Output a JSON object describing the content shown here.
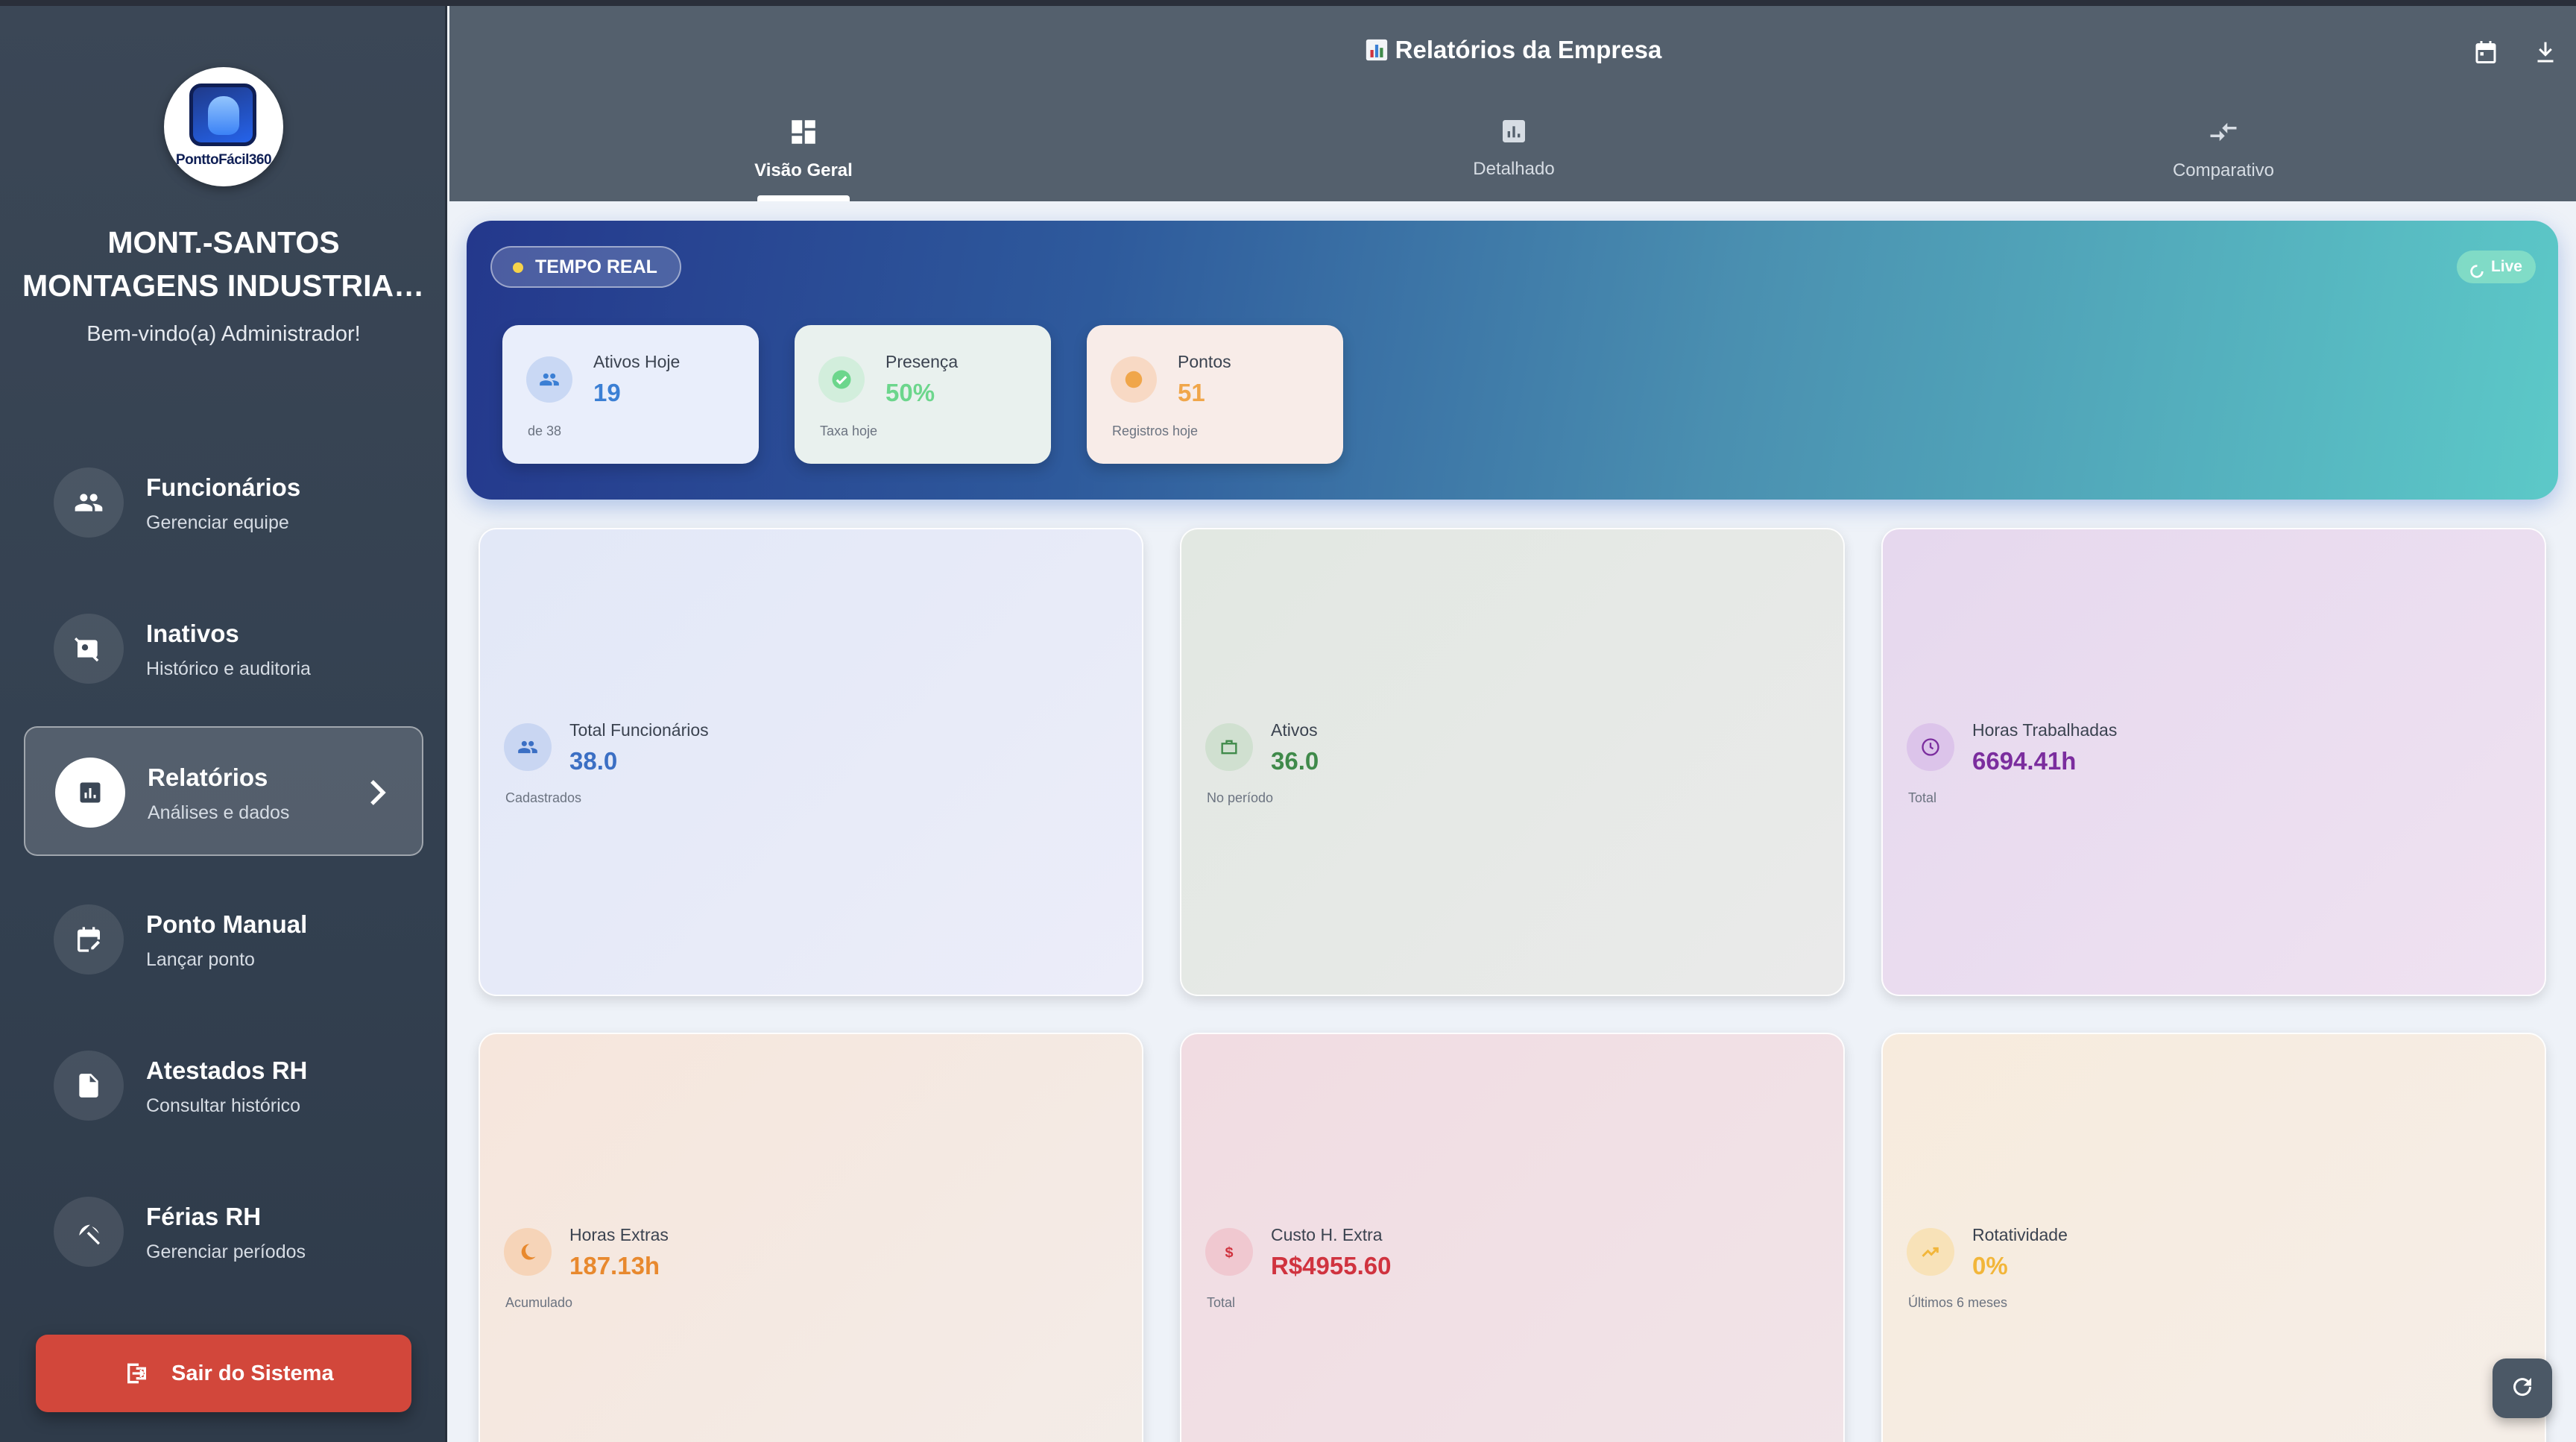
{
  "sidebar": {
    "logo_text": "PonttoFácil360",
    "company_line1": "MONT.-SANTOS",
    "company_line2": "MONTAGENS INDUSTRIAI...",
    "welcome": "Bem-vindo(a) Administrador!",
    "items": [
      {
        "label": "Funcionários",
        "sub": "Gerenciar equipe",
        "icon": "people-icon"
      },
      {
        "label": "Inativos",
        "sub": "Histórico e auditoria",
        "icon": "person-off-icon"
      },
      {
        "label": "Relatórios",
        "sub": "Análises e dados",
        "icon": "analytics-icon",
        "active": true
      },
      {
        "label": "Ponto Manual",
        "sub": "Lançar ponto",
        "icon": "edit-calendar-icon"
      },
      {
        "label": "Atestados RH",
        "sub": "Consultar histórico",
        "icon": "document-icon"
      },
      {
        "label": "Férias RH",
        "sub": "Gerenciar períodos",
        "icon": "beach-icon"
      }
    ],
    "logout_label": "Sair do Sistema"
  },
  "header": {
    "title": "Relatórios da Empresa",
    "tabs": [
      {
        "label": "Visão Geral",
        "icon": "dashboard-icon",
        "active": true
      },
      {
        "label": "Detalhado",
        "icon": "bar-chart-icon"
      },
      {
        "label": "Comparativo",
        "icon": "compare-arrows-icon"
      }
    ]
  },
  "realtime": {
    "badge": "TEMPO REAL",
    "live": "Live",
    "cards": [
      {
        "label": "Ativos Hoje",
        "value": "19",
        "sub": "de 38",
        "color": "#3b7fd4"
      },
      {
        "label": "Presença",
        "value": "50%",
        "sub": "Taxa hoje",
        "color": "#6cd68c"
      },
      {
        "label": "Pontos",
        "value": "51",
        "sub": "Registros hoje",
        "color": "#f0a64a"
      }
    ]
  },
  "stats": [
    {
      "label": "Total Funcionários",
      "value": "38.0",
      "sub": "Cadastrados",
      "color": "#3b6fc4"
    },
    {
      "label": "Ativos",
      "value": "36.0",
      "sub": "No período",
      "color": "#3f8a4a"
    },
    {
      "label": "Horas Trabalhadas",
      "value": "6694.41h",
      "sub": "Total",
      "color": "#7b2d9e"
    },
    {
      "label": "Horas Extras",
      "value": "187.13h",
      "sub": "Acumulado",
      "color": "#e8892e"
    },
    {
      "label": "Custo H. Extra",
      "value": "R$4955.60",
      "sub": "Total",
      "color": "#d0333f"
    },
    {
      "label": "Rotatividade",
      "value": "0%",
      "sub": "Últimos 6 meses",
      "color": "#f2b63a"
    }
  ]
}
